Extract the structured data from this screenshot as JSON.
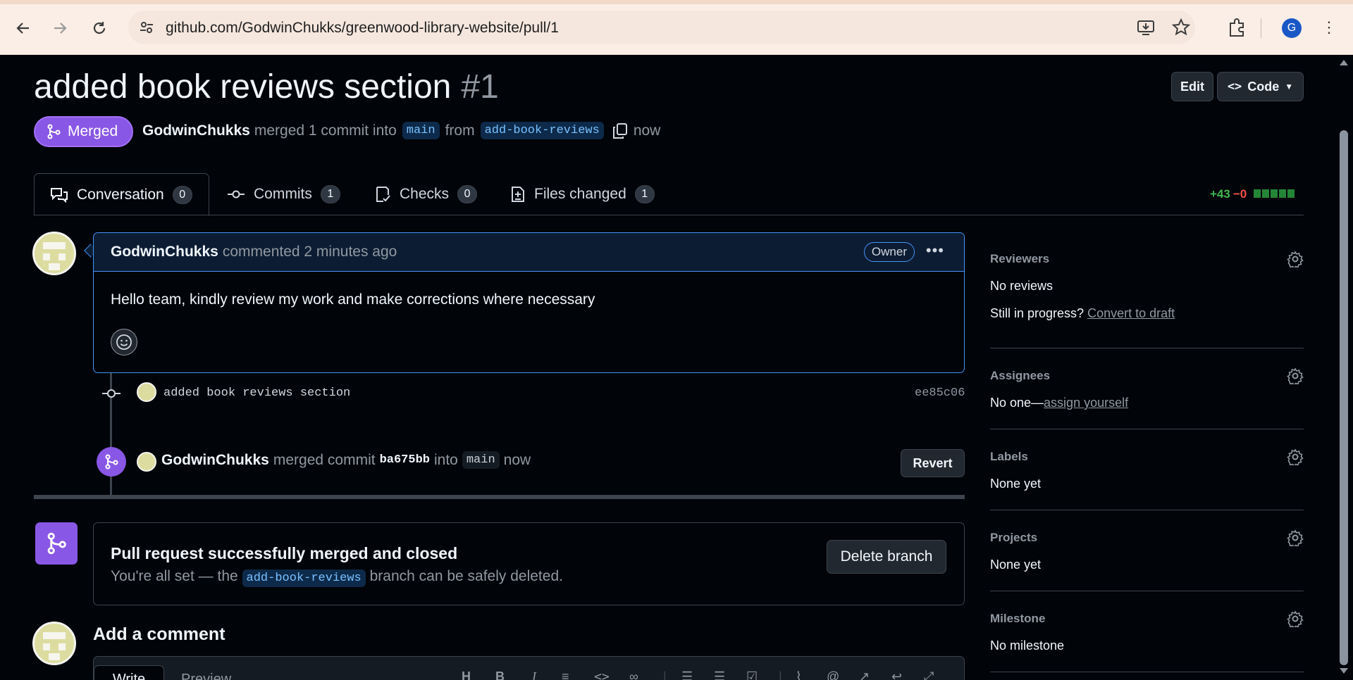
{
  "browser": {
    "url": "github.com/GodwinChukks/greenwood-library-website/pull/1",
    "profile_initial": "G"
  },
  "pr": {
    "title": "added book reviews section",
    "number": "#1",
    "state": "Merged",
    "author": "GodwinChukks",
    "action_text": "merged 1 commit into",
    "base_branch": "main",
    "from_text": "from",
    "head_branch": "add-book-reviews",
    "time": "now",
    "edit_label": "Edit",
    "code_label": "Code"
  },
  "tabs": [
    {
      "label": "Conversation",
      "count": "0"
    },
    {
      "label": "Commits",
      "count": "1"
    },
    {
      "label": "Checks",
      "count": "0"
    },
    {
      "label": "Files changed",
      "count": "1"
    }
  ],
  "diffstat": {
    "additions": "+43",
    "deletions": "−0"
  },
  "comment": {
    "author": "GodwinChukks",
    "action": "commented 2 minutes ago",
    "role": "Owner",
    "body": "Hello team, kindly review my work and make corrections where necessary"
  },
  "commit": {
    "message": "added book reviews section",
    "sha": "ee85c06"
  },
  "merge_event": {
    "author": "GodwinChukks",
    "text": "merged commit",
    "sha": "ba675bb",
    "into": "into",
    "branch": "main",
    "time": "now",
    "revert_label": "Revert"
  },
  "merge_box": {
    "title": "Pull request successfully merged and closed",
    "text_before": "You're all set — the",
    "branch": "add-book-reviews",
    "text_after": "branch can be safely deleted.",
    "delete_label": "Delete branch"
  },
  "add_comment": {
    "heading": "Add a comment",
    "write_tab": "Write",
    "preview_tab": "Preview"
  },
  "sidebar": {
    "reviewers": {
      "label": "Reviewers",
      "value": "No reviews",
      "draft_prompt": "Still in progress?",
      "draft_link": "Convert to draft"
    },
    "assignees": {
      "label": "Assignees",
      "value": "No one—",
      "link": "assign yourself"
    },
    "labels": {
      "label": "Labels",
      "value": "None yet"
    },
    "projects": {
      "label": "Projects",
      "value": "None yet"
    },
    "milestone": {
      "label": "Milestone",
      "value": "No milestone"
    }
  },
  "colors": {
    "merged_purple": "#8957e5",
    "accent_blue": "#4493f8",
    "addition_green": "#3fb950",
    "deletion_red": "#f85149"
  }
}
